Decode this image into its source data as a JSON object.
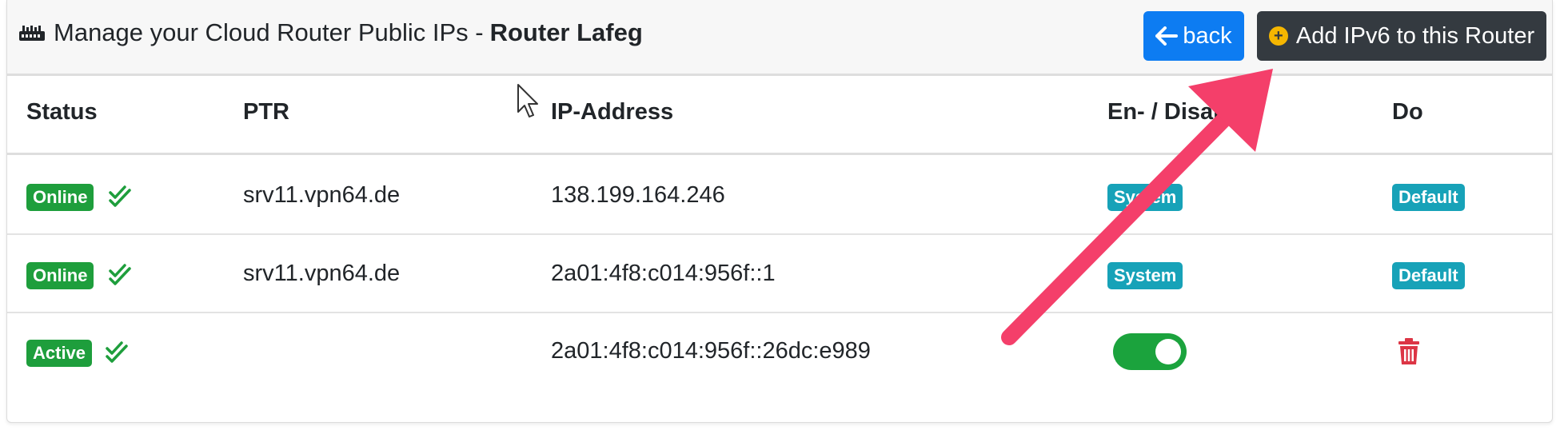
{
  "header": {
    "icon": "router-icon",
    "title": "Manage your Cloud Router Public IPs -",
    "router_name": "Router Lafeg",
    "back_label": "back",
    "add_label": "Add IPv6 to this Router"
  },
  "table": {
    "columns": [
      "Status",
      "PTR",
      "IP-Address",
      "En- / Disable",
      "Do"
    ],
    "rows": [
      {
        "status": "Online",
        "ptr": "srv11.vpn64.de",
        "ip": "138.199.164.246",
        "enable": "System",
        "do": "Default"
      },
      {
        "status": "Online",
        "ptr": "srv11.vpn64.de",
        "ip": "2a01:4f8:c014:956f::1",
        "enable": "System",
        "do": "Default"
      },
      {
        "status": "Active",
        "ptr": "",
        "ip": "2a01:4f8:c014:956f::26dc:e989",
        "enable": "toggle-on",
        "do": "trash-icon"
      }
    ]
  },
  "colors": {
    "primary": "#0d7cf2",
    "dark": "#343a40",
    "success": "#1e9e3c",
    "info": "#17a2b8",
    "danger": "#dc3545",
    "annotation_arrow": "#f43f6a"
  }
}
